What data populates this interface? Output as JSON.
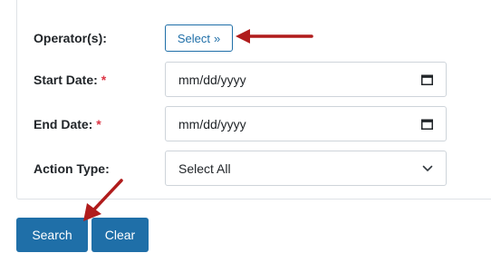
{
  "form": {
    "operator": {
      "label": "Operator(s):",
      "button_label": "Select",
      "button_icon": "chevrons-right-icon"
    },
    "start_date": {
      "label": "Start Date:",
      "required_mark": "*",
      "placeholder": "mm/dd/yyyy",
      "icon": "calendar-icon"
    },
    "end_date": {
      "label": "End Date:",
      "required_mark": "*",
      "placeholder": "mm/dd/yyyy",
      "icon": "calendar-icon"
    },
    "action_type": {
      "label": "Action Type:",
      "selected": "Select All",
      "icon": "chevron-down-icon"
    }
  },
  "actions": {
    "search_label": "Search",
    "clear_label": "Clear"
  },
  "colors": {
    "primary": "#1f6fa8",
    "required": "#dc3545",
    "annotation_arrow": "#b01c1c",
    "border": "#ced4da"
  }
}
